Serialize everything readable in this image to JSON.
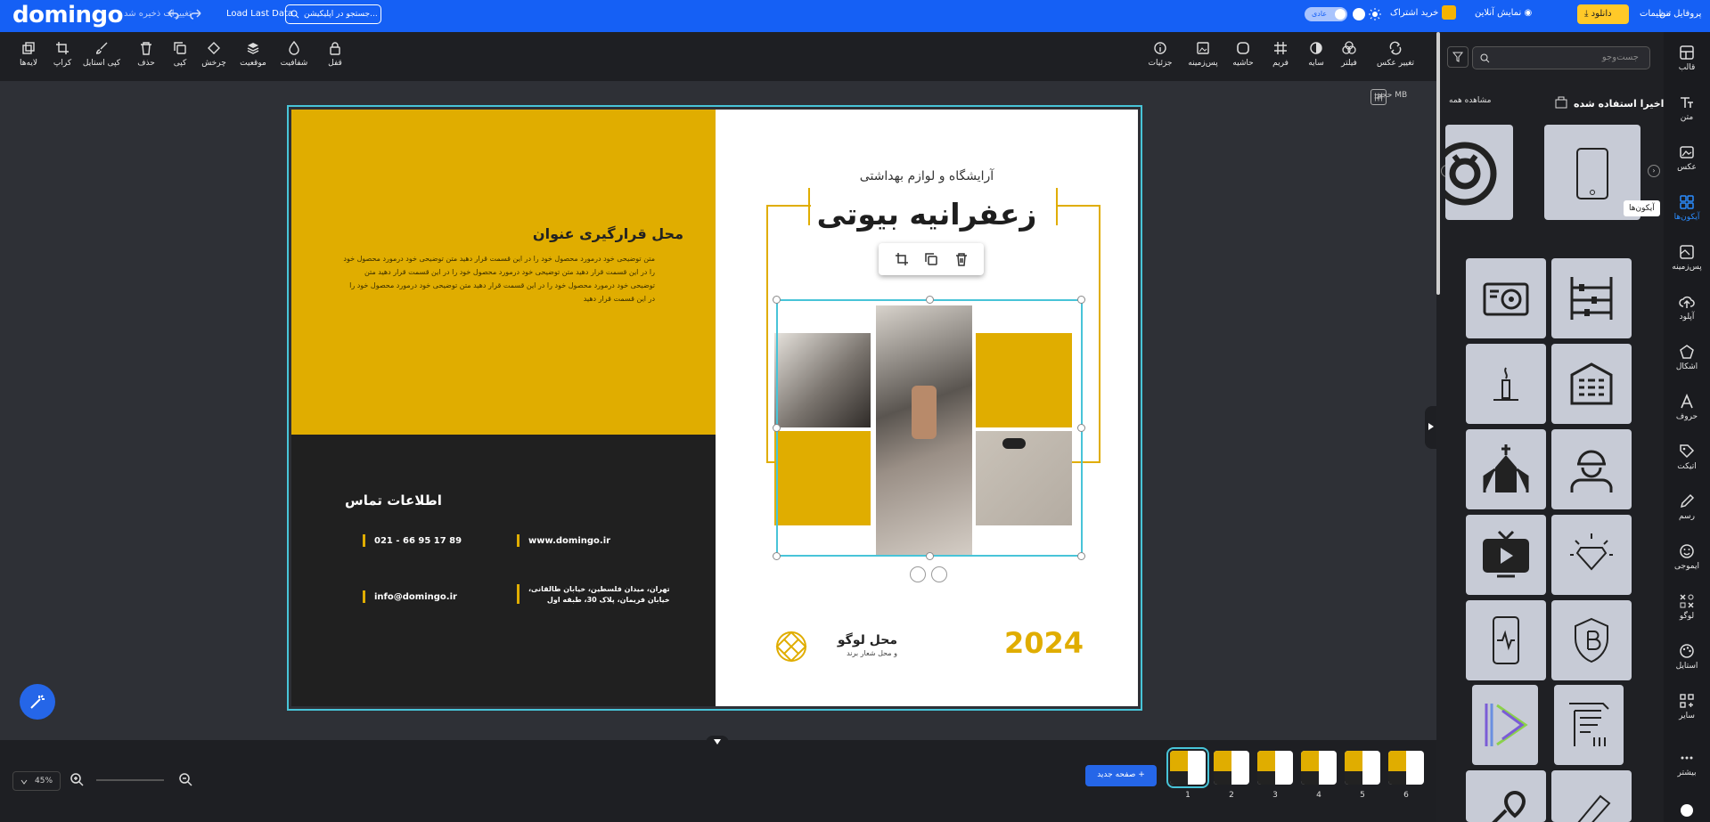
{
  "topbar": {
    "logo": "domingo",
    "save_status": "تغییرات ذخیره شد",
    "load_last": "Load Last Data",
    "project_name": "جستجو در اپلیکیشن...",
    "theme_label": "عادی",
    "buy_subscription": "خرید اشتراک",
    "online_show": "نمایش آنلاین",
    "download": "دانلود",
    "settings": "تنظیمات",
    "profile": "پروفایل من"
  },
  "toolbar": {
    "left_tools": [
      {
        "label": "لایه‌ها",
        "icon": "layers-icon"
      },
      {
        "label": "کراپ",
        "icon": "crop-icon"
      },
      {
        "label": "کپی استایل",
        "icon": "paint-brush-icon"
      },
      {
        "label": "حذف",
        "icon": "trash-icon"
      },
      {
        "label": "کپی",
        "icon": "copy-icon"
      },
      {
        "label": "چرخش",
        "icon": "rotate-icon"
      },
      {
        "label": "موقعیت",
        "icon": "position-icon"
      },
      {
        "label": "شفافیت",
        "icon": "opacity-icon"
      },
      {
        "label": "قفل",
        "icon": "lock-icon"
      }
    ],
    "right_tools": [
      {
        "label": "جزئیات",
        "icon": "info-icon"
      },
      {
        "label": "پس‌زمینه",
        "icon": "background-icon"
      },
      {
        "label": "حاشیه",
        "icon": "border-icon"
      },
      {
        "label": "فریم",
        "icon": "frame-icon"
      },
      {
        "label": "سایه",
        "icon": "shadow-icon"
      },
      {
        "label": "فیلتر",
        "icon": "filter-icon"
      },
      {
        "label": "تغییر عکس",
        "icon": "replace-image-icon"
      }
    ]
  },
  "canvas": {
    "size_label": "حجم MB",
    "design": {
      "left_heading": "محل قرارگیری عنوان",
      "left_body": "متن توضیحی خود درمورد محصول خود را در این قسمت قرار دهید متن توضیحی خود درمورد محصول خود را در این قسمت قرار دهید متن توضیحی خود درمورد محصول خود را در این قسمت قرار دهید متن توضیحی خود درمورد محصول خود را در این قسمت قرار دهید متن توضیحی خود درمورد محصول خود را در این قسمت قرار دهید",
      "contact_title": "اطلاعات تماس",
      "phone": "021 - 66 95 17 89",
      "website": "www.domingo.ir",
      "email": "info@domingo.ir",
      "address_line1": "تهران، میدان فلسطین، خیابان طالقانی،",
      "address_line2": "خیابان فریمان، پلاک 30، طبقه اول",
      "subtitle": "آرایشگاه و لوازم بهداشتی",
      "main_title": "زعفرانیه بیوتی",
      "logo_text": "محل لوگو",
      "logo_sub": "و محل شعار برند",
      "year": "2024"
    }
  },
  "side_panel": {
    "search_placeholder": "جست‌وجو",
    "recent_title": "اخیرا استفاده شده",
    "see_all": "مشاهده همه",
    "recent_icons": [
      "smartphone-icon",
      "lifebuoy-icon"
    ],
    "icons": [
      "abacus-icon",
      "hard-drive-icon",
      "building-icon",
      "candle-icon",
      "worker-helmet-icon",
      "church-icon",
      "diamond-icon",
      "tv-play-icon",
      "bitcoin-shield-icon",
      "heartbeat-phone-icon",
      "invoice-icon",
      "play-logo-icon",
      "pen-icon",
      "map-pin-icon"
    ]
  },
  "nav_rail": {
    "items": [
      {
        "label": "قالب",
        "icon": "template-icon"
      },
      {
        "label": "متن",
        "icon": "text-icon"
      },
      {
        "label": "عکس",
        "icon": "image-icon"
      },
      {
        "label": "آیکون‌ها",
        "icon": "icons-grid-icon"
      },
      {
        "label": "پس‌زمینه",
        "icon": "background-icon"
      },
      {
        "label": "آپلود",
        "icon": "upload-icon"
      },
      {
        "label": "اشکال",
        "icon": "shapes-icon"
      },
      {
        "label": "حروف",
        "icon": "font-icon"
      },
      {
        "label": "اتیکت",
        "icon": "tag-icon"
      },
      {
        "label": "رسم",
        "icon": "pencil-icon"
      },
      {
        "label": "ایموجی",
        "icon": "emoji-icon"
      },
      {
        "label": "لوگو",
        "icon": "logo-icon"
      },
      {
        "label": "استایل",
        "icon": "style-icon"
      },
      {
        "label": "سایر",
        "icon": "more-grid-icon"
      },
      {
        "label": "بیشتر",
        "icon": "dots-icon"
      }
    ],
    "tooltip": "آیکون‌ها"
  },
  "bottom": {
    "zoom": "45%",
    "new_page": "صفحه جدید",
    "pages": [
      "1",
      "2",
      "3",
      "4",
      "5",
      "6"
    ]
  },
  "colors": {
    "accent": "#1560f5",
    "brand_yellow": "#e0ad00",
    "selection": "#48c4d8"
  }
}
